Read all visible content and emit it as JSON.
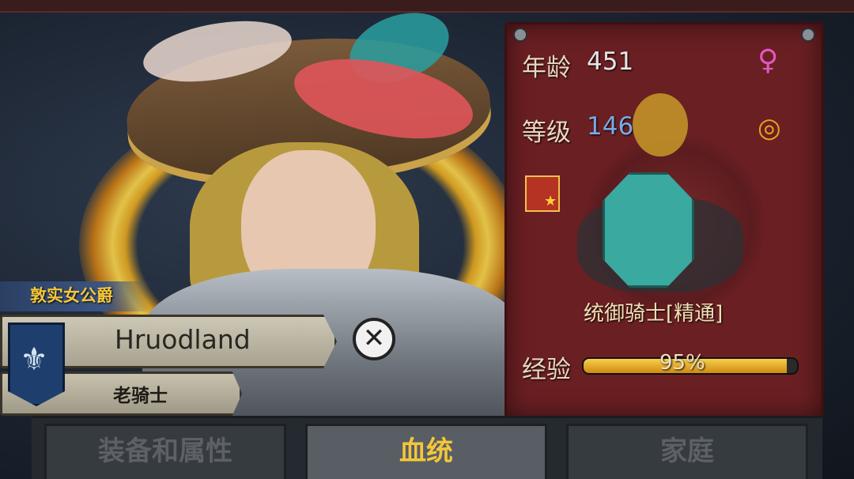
{
  "character": {
    "title": "敦实女公爵",
    "name": "Hruodland",
    "rank": "老骑士"
  },
  "stats": {
    "age_label": "年龄",
    "age_value": "451",
    "level_label": "等级",
    "level_value": "146"
  },
  "unit": {
    "name": "统御骑士[精通]"
  },
  "experience": {
    "label": "经验",
    "percent": 95,
    "percent_text": "95%"
  },
  "icons": {
    "close": "close-icon",
    "gender": "female-icon",
    "marriage": "ring-icon",
    "heraldry": "banner-icon",
    "class_badge": "horse-star-icon"
  },
  "tabs": [
    {
      "label": "装备和属性",
      "active": false
    },
    {
      "label": "血统",
      "active": true
    },
    {
      "label": "家庭",
      "active": false
    }
  ],
  "colors": {
    "panel": "#6a1f23",
    "accent_gold": "#f3c63b",
    "level_blue": "#7aa9e6",
    "gender_pink": "#e158c0"
  }
}
